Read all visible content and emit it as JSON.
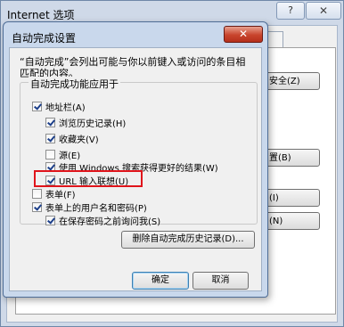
{
  "outer_window": {
    "title": "Internet 选项",
    "help_label": "?",
    "close_label": "✕",
    "button_labels": [
      "安全(Z)",
      "置(B)",
      "(I)",
      "(N)"
    ]
  },
  "dialog": {
    "title": "自动完成设置",
    "close_label": "✕",
    "description": "“自动完成”会列出可能与你以前键入或访问的条目相匹配的内容。",
    "group_label": "自动完成功能应用于",
    "options": [
      {
        "label": "地址栏(A)",
        "checked": true
      },
      {
        "label": "浏览历史记录(H)",
        "checked": true
      },
      {
        "label": "收藏夹(V)",
        "checked": true
      },
      {
        "label": "源(E)",
        "checked": false
      },
      {
        "label": "使用 Windows 搜索获得更好的结果(W)",
        "checked": true
      },
      {
        "label": "URL 输入联想(U)",
        "checked": true
      },
      {
        "label": "表单(F)",
        "checked": false
      },
      {
        "label": "表单上的用户名和密码(P)",
        "checked": true
      },
      {
        "label": "在保存密码之前询问我(S)",
        "checked": true
      }
    ],
    "delete_history_label": "删除自动完成历史记录(D)...",
    "ok_label": "确定",
    "cancel_label": "取消"
  },
  "colors": {
    "highlight": "#e0141b",
    "dialog_frame": "#c9d8ec",
    "close_button": "#c8442c"
  }
}
